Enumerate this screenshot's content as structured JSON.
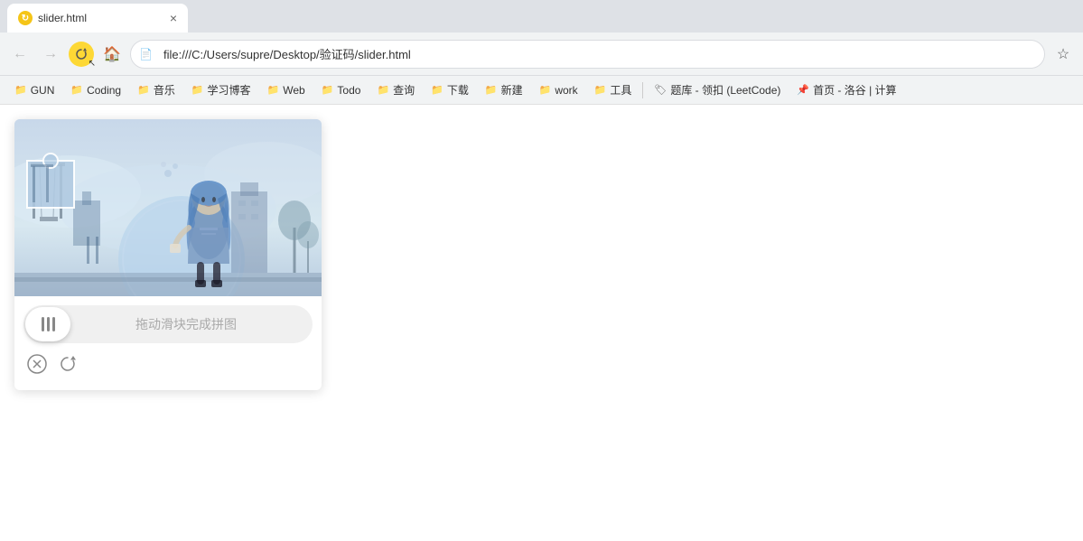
{
  "browser": {
    "tab": {
      "title": "slider.html",
      "favicon": "↻"
    },
    "address": "file:///C:/Users/supre/Desktop/验证码/slider.html",
    "address_icon": "📄"
  },
  "bookmarks": [
    {
      "label": "GUN",
      "icon": "📁"
    },
    {
      "label": "Coding",
      "icon": "📁"
    },
    {
      "label": "音乐",
      "icon": "📁"
    },
    {
      "label": "学习博客",
      "icon": "📁"
    },
    {
      "label": "Web",
      "icon": "📁"
    },
    {
      "label": "Todo",
      "icon": "📁"
    },
    {
      "label": "查询",
      "icon": "📁"
    },
    {
      "label": "下载",
      "icon": "📁"
    },
    {
      "label": "新建",
      "icon": "📁"
    },
    {
      "label": "work",
      "icon": "📁"
    },
    {
      "label": "工具",
      "icon": "📁"
    },
    {
      "label": "题库 - 领扣 (LeetCode)",
      "icon": "🏷"
    },
    {
      "label": "首页 - 洛谷 | 计算",
      "icon": "📌"
    }
  ],
  "captcha": {
    "slider_text": "拖动滑块完成拼图",
    "close_label": "✕",
    "refresh_label": "↻"
  }
}
